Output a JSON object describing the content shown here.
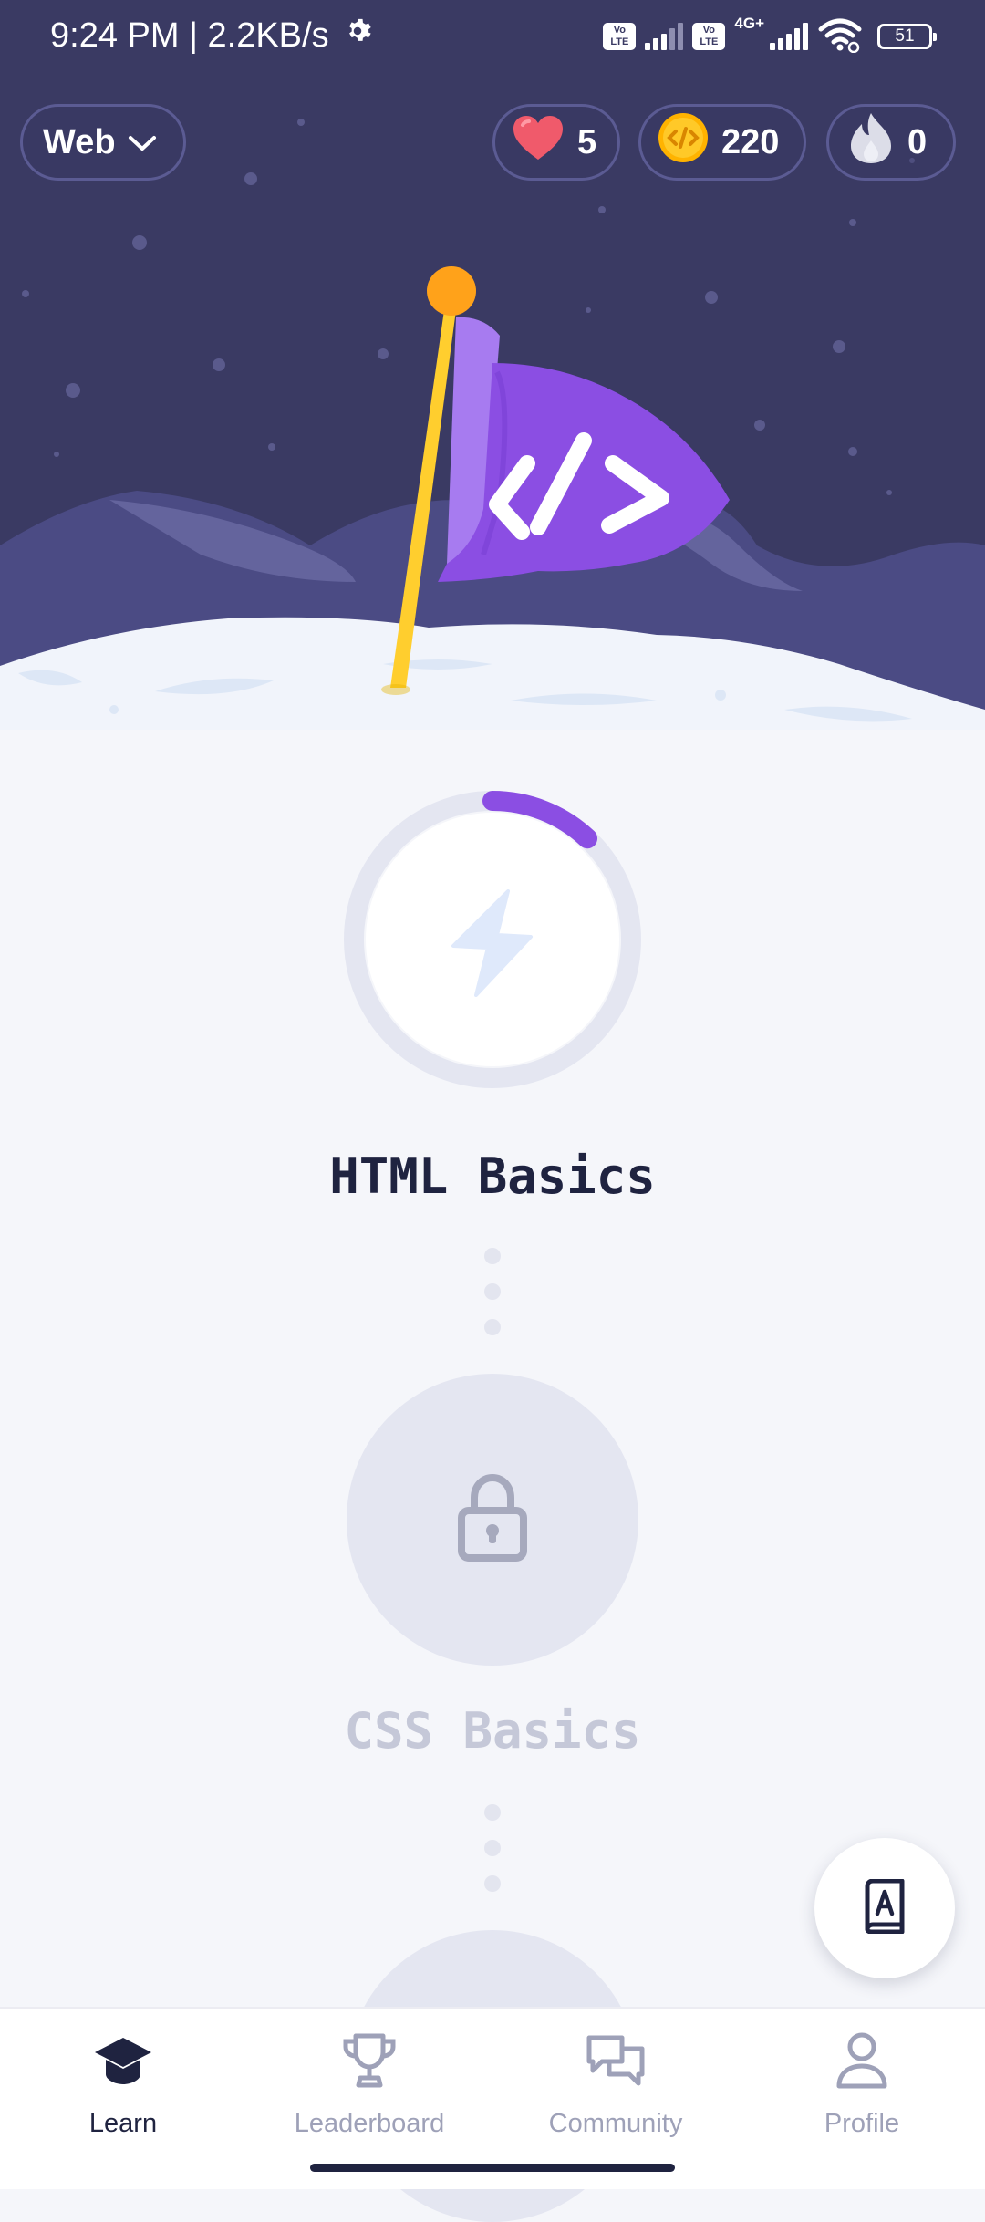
{
  "status_bar": {
    "time_speed": "9:24 PM | 2.2KB/s",
    "network_type": "4G+",
    "volte_1": "Vo LTE",
    "volte_2": "Vo LTE",
    "battery": "51"
  },
  "header": {
    "course_selector": "Web",
    "hearts": "5",
    "coins": "220",
    "streak": "0"
  },
  "path": {
    "current_module": {
      "title": "HTML Basics",
      "progress_fraction": 0.12
    },
    "next_module": {
      "title": "CSS Basics",
      "state": "locked"
    }
  },
  "bottom_nav": {
    "items": [
      {
        "label": "Learn",
        "icon": "graduation-cap-icon",
        "active": true
      },
      {
        "label": "Leaderboard",
        "icon": "trophy-icon",
        "active": false
      },
      {
        "label": "Community",
        "icon": "chat-bubbles-icon",
        "active": false
      },
      {
        "label": "Profile",
        "icon": "user-icon",
        "active": false
      }
    ]
  },
  "colors": {
    "header_bg": "#3a3a63",
    "accent_purple": "#8b4ee3",
    "heart": "#f05a6b",
    "coin": "#ffc107",
    "text_dark": "#1f2340",
    "muted": "#9ea1b8"
  }
}
